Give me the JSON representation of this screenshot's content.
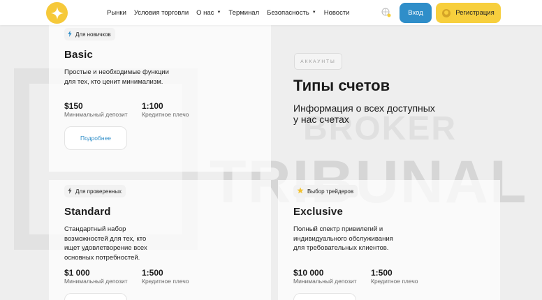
{
  "header": {
    "nav": [
      {
        "label": "Рынки",
        "dropdown": false
      },
      {
        "label": "Условия торговли",
        "dropdown": false
      },
      {
        "label": "О нас",
        "dropdown": true
      },
      {
        "label": "Терминал",
        "dropdown": false
      },
      {
        "label": "Безопасность",
        "dropdown": true
      },
      {
        "label": "Новости",
        "dropdown": false
      }
    ],
    "login_label": "Вход",
    "register_label": "Регистрация"
  },
  "hero": {
    "tag": "АККАУНТЫ",
    "title": "Типы счетов",
    "subtitle": "Информация о всех доступных у нас счетах"
  },
  "watermark": {
    "line1": "BROKER",
    "line2": "TRIBUNAL"
  },
  "accounts": {
    "basic": {
      "badge": "Для новичков",
      "title": "Basic",
      "desc": "Простые и необходимые функции для тех, кто ценит минимализм.",
      "deposit": "$150",
      "deposit_label": "Минимальный депозит",
      "leverage": "1:100",
      "leverage_label": "Кредитное плечо",
      "more_label": "Подробнее"
    },
    "standard": {
      "badge": "Для проверенных",
      "title": "Standard",
      "desc": "Стандартный набор возможностей для тех, кто ищет удовлетворение всех основных потребностей.",
      "deposit": "$1 000",
      "deposit_label": "Минимальный депозит",
      "leverage": "1:500",
      "leverage_label": "Кредитное плечо"
    },
    "exclusive": {
      "badge": "Выбор трейдеров",
      "title": "Exclusive",
      "desc": "Полный спектр привилегий и индивидуального обслуживания для требовательных клиентов.",
      "deposit": "$10 000",
      "deposit_label": "Минимальный депозит",
      "leverage": "1:500",
      "leverage_label": "Кредитное плечо"
    }
  },
  "colors": {
    "accent_blue": "#2f8ec9",
    "accent_yellow": "#f7cf3d"
  }
}
